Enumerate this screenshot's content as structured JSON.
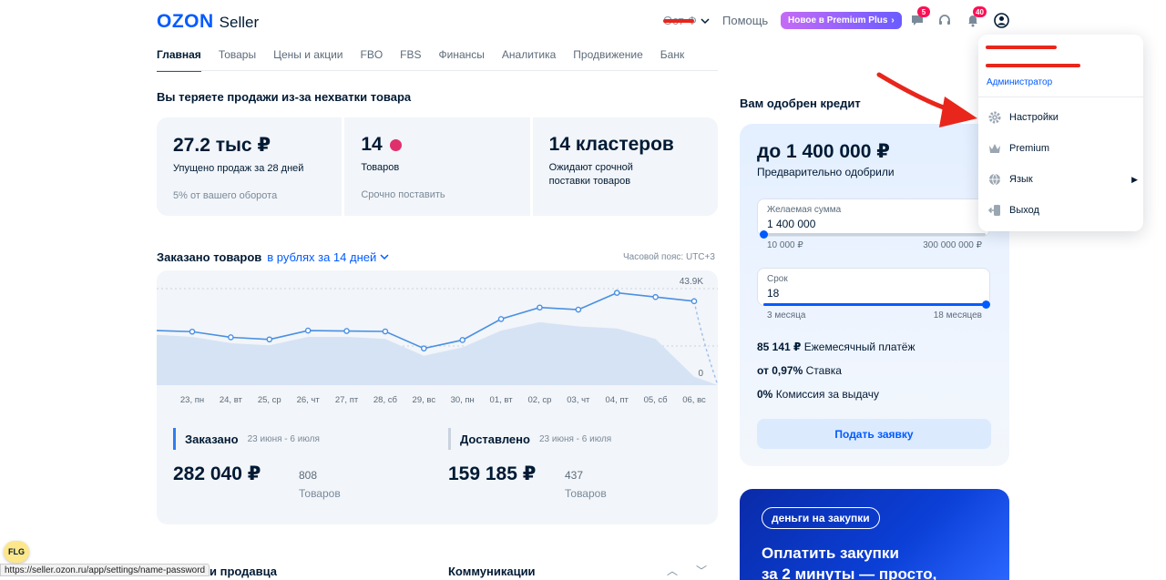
{
  "header": {
    "logo_brand": "OZON",
    "logo_product": "Seller",
    "org_name": "Ост-Ф",
    "help_label": "Помощь",
    "premium_label": "Новое в Premium Plus",
    "chat_badge": "5",
    "notif_badge": "40"
  },
  "nav": {
    "tabs": [
      {
        "label": "Главная",
        "active": true
      },
      {
        "label": "Товары"
      },
      {
        "label": "Цены и акции"
      },
      {
        "label": "FBO"
      },
      {
        "label": "FBS"
      },
      {
        "label": "Финансы"
      },
      {
        "label": "Аналитика"
      },
      {
        "label": "Продвижение"
      },
      {
        "label": "Банк"
      }
    ]
  },
  "lost_sales": {
    "title": "Вы теряете продажи из-за нехватки товара",
    "cards": [
      {
        "big": "27.2 тыс ₽",
        "label": "Упущено продаж за 28 дней",
        "sub": "5% от вашего оборота"
      },
      {
        "big": "14",
        "label": "Товаров",
        "sub": "Срочно поставить"
      },
      {
        "big": "14 кластеров",
        "label": "Ожидают срочной поставки товаров",
        "sub": ""
      }
    ]
  },
  "orders": {
    "title": "Заказано товаров",
    "period_link": "в рублях за 14 дней",
    "timezone": "Часовой пояс: UTC+3",
    "ordered": {
      "title": "Заказано",
      "dates": "23 июня - 6 июля",
      "amount": "282 040 ₽",
      "count": "808",
      "count_label": "Товаров"
    },
    "delivered": {
      "title": "Доставлено",
      "dates": "23 июня - 6 июля",
      "amount": "159 185 ₽",
      "count": "437",
      "count_label": "Товаров"
    }
  },
  "chart_data": {
    "type": "line",
    "x": [
      "23, пн",
      "24, вт",
      "25, ср",
      "26, чт",
      "27, пт",
      "28, сб",
      "29, вс",
      "30, пн",
      "01, вт",
      "02, ср",
      "03, чт",
      "04, пт",
      "05, сб",
      "06, вс"
    ],
    "series": [
      {
        "values": [
          25.5,
          22.8,
          21.8,
          26.0,
          25.8,
          25.6,
          17.5,
          21.5,
          31.5,
          37.0,
          36.0,
          44.0,
          42.0,
          40.0
        ]
      }
    ],
    "area_values": [
      23,
      20,
      19,
      23,
      23,
      22,
      14,
      18,
      26,
      30,
      28,
      27,
      22,
      4
    ],
    "ylim": [
      0,
      46
    ],
    "y_ticks": [
      "43.9K",
      "0"
    ],
    "grid": true
  },
  "credit": {
    "title": "Вам одобрен кредит",
    "amount": "до 1 400 000 ₽",
    "preapproved": "Предварительно одобрили",
    "sum_label": "Желаемая сумма",
    "sum_value": "1 400 000",
    "sum_min": "10 000 ₽",
    "sum_max": "300 000 000 ₽",
    "sum_fraction": 0.0,
    "term_label": "Срок",
    "term_value": "18",
    "term_min": "3 месяца",
    "term_max": "18 месяцев",
    "term_fraction": 1.0,
    "monthly_value": "85 141 ₽",
    "monthly_label": "Ежемесячный платёж",
    "rate_value": "от 0,97%",
    "rate_label": "Ставка",
    "fee_value": "0%",
    "fee_label": "Комиссия за выдачу",
    "apply_label": "Подать заявку"
  },
  "promo": {
    "pill": "деньги на закупки",
    "headline_1": "Оплатить закупки",
    "headline_2": "за 2 минуты — просто,"
  },
  "account_menu": {
    "role": "Администратор",
    "items": [
      {
        "label": "Настройки",
        "icon": "gear-icon"
      },
      {
        "label": "Premium",
        "icon": "crown-icon"
      },
      {
        "label": "Язык",
        "icon": "globe-icon",
        "submenu": true
      },
      {
        "label": "Выход",
        "icon": "logout-icon"
      }
    ]
  },
  "bottom": {
    "left_title": "и продавца",
    "right_title": "Коммуникации"
  },
  "status_url": "https://seller.ozon.ru/app/settings/name-password",
  "flg_label": "FLG",
  "colors": {
    "accent": "#005bff",
    "annotation_arrow": "#e8261c",
    "redaction": "#e8261c"
  }
}
